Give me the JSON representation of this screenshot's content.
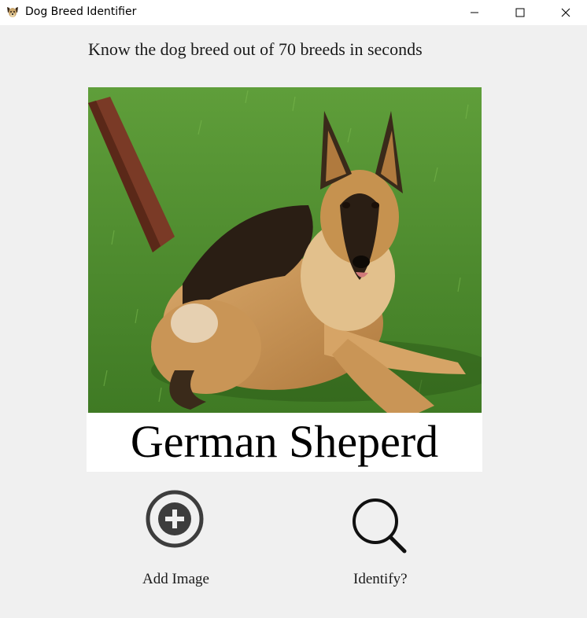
{
  "window": {
    "title": "Dog Breed Identifier",
    "icon": "dog-face-icon"
  },
  "tagline": "Know the dog breed out of 70 breeds in seconds",
  "result": {
    "breed": "German Sheperd"
  },
  "actions": {
    "add_label": "Add Image",
    "add_icon": "plus-circle-icon",
    "identify_label": "Identify?",
    "identify_icon": "magnifier-icon"
  },
  "colors": {
    "background": "#f0f0f0",
    "titlebar": "#ffffff",
    "result_box": "#ffffff",
    "icon_dark": "#3d3d3d"
  }
}
